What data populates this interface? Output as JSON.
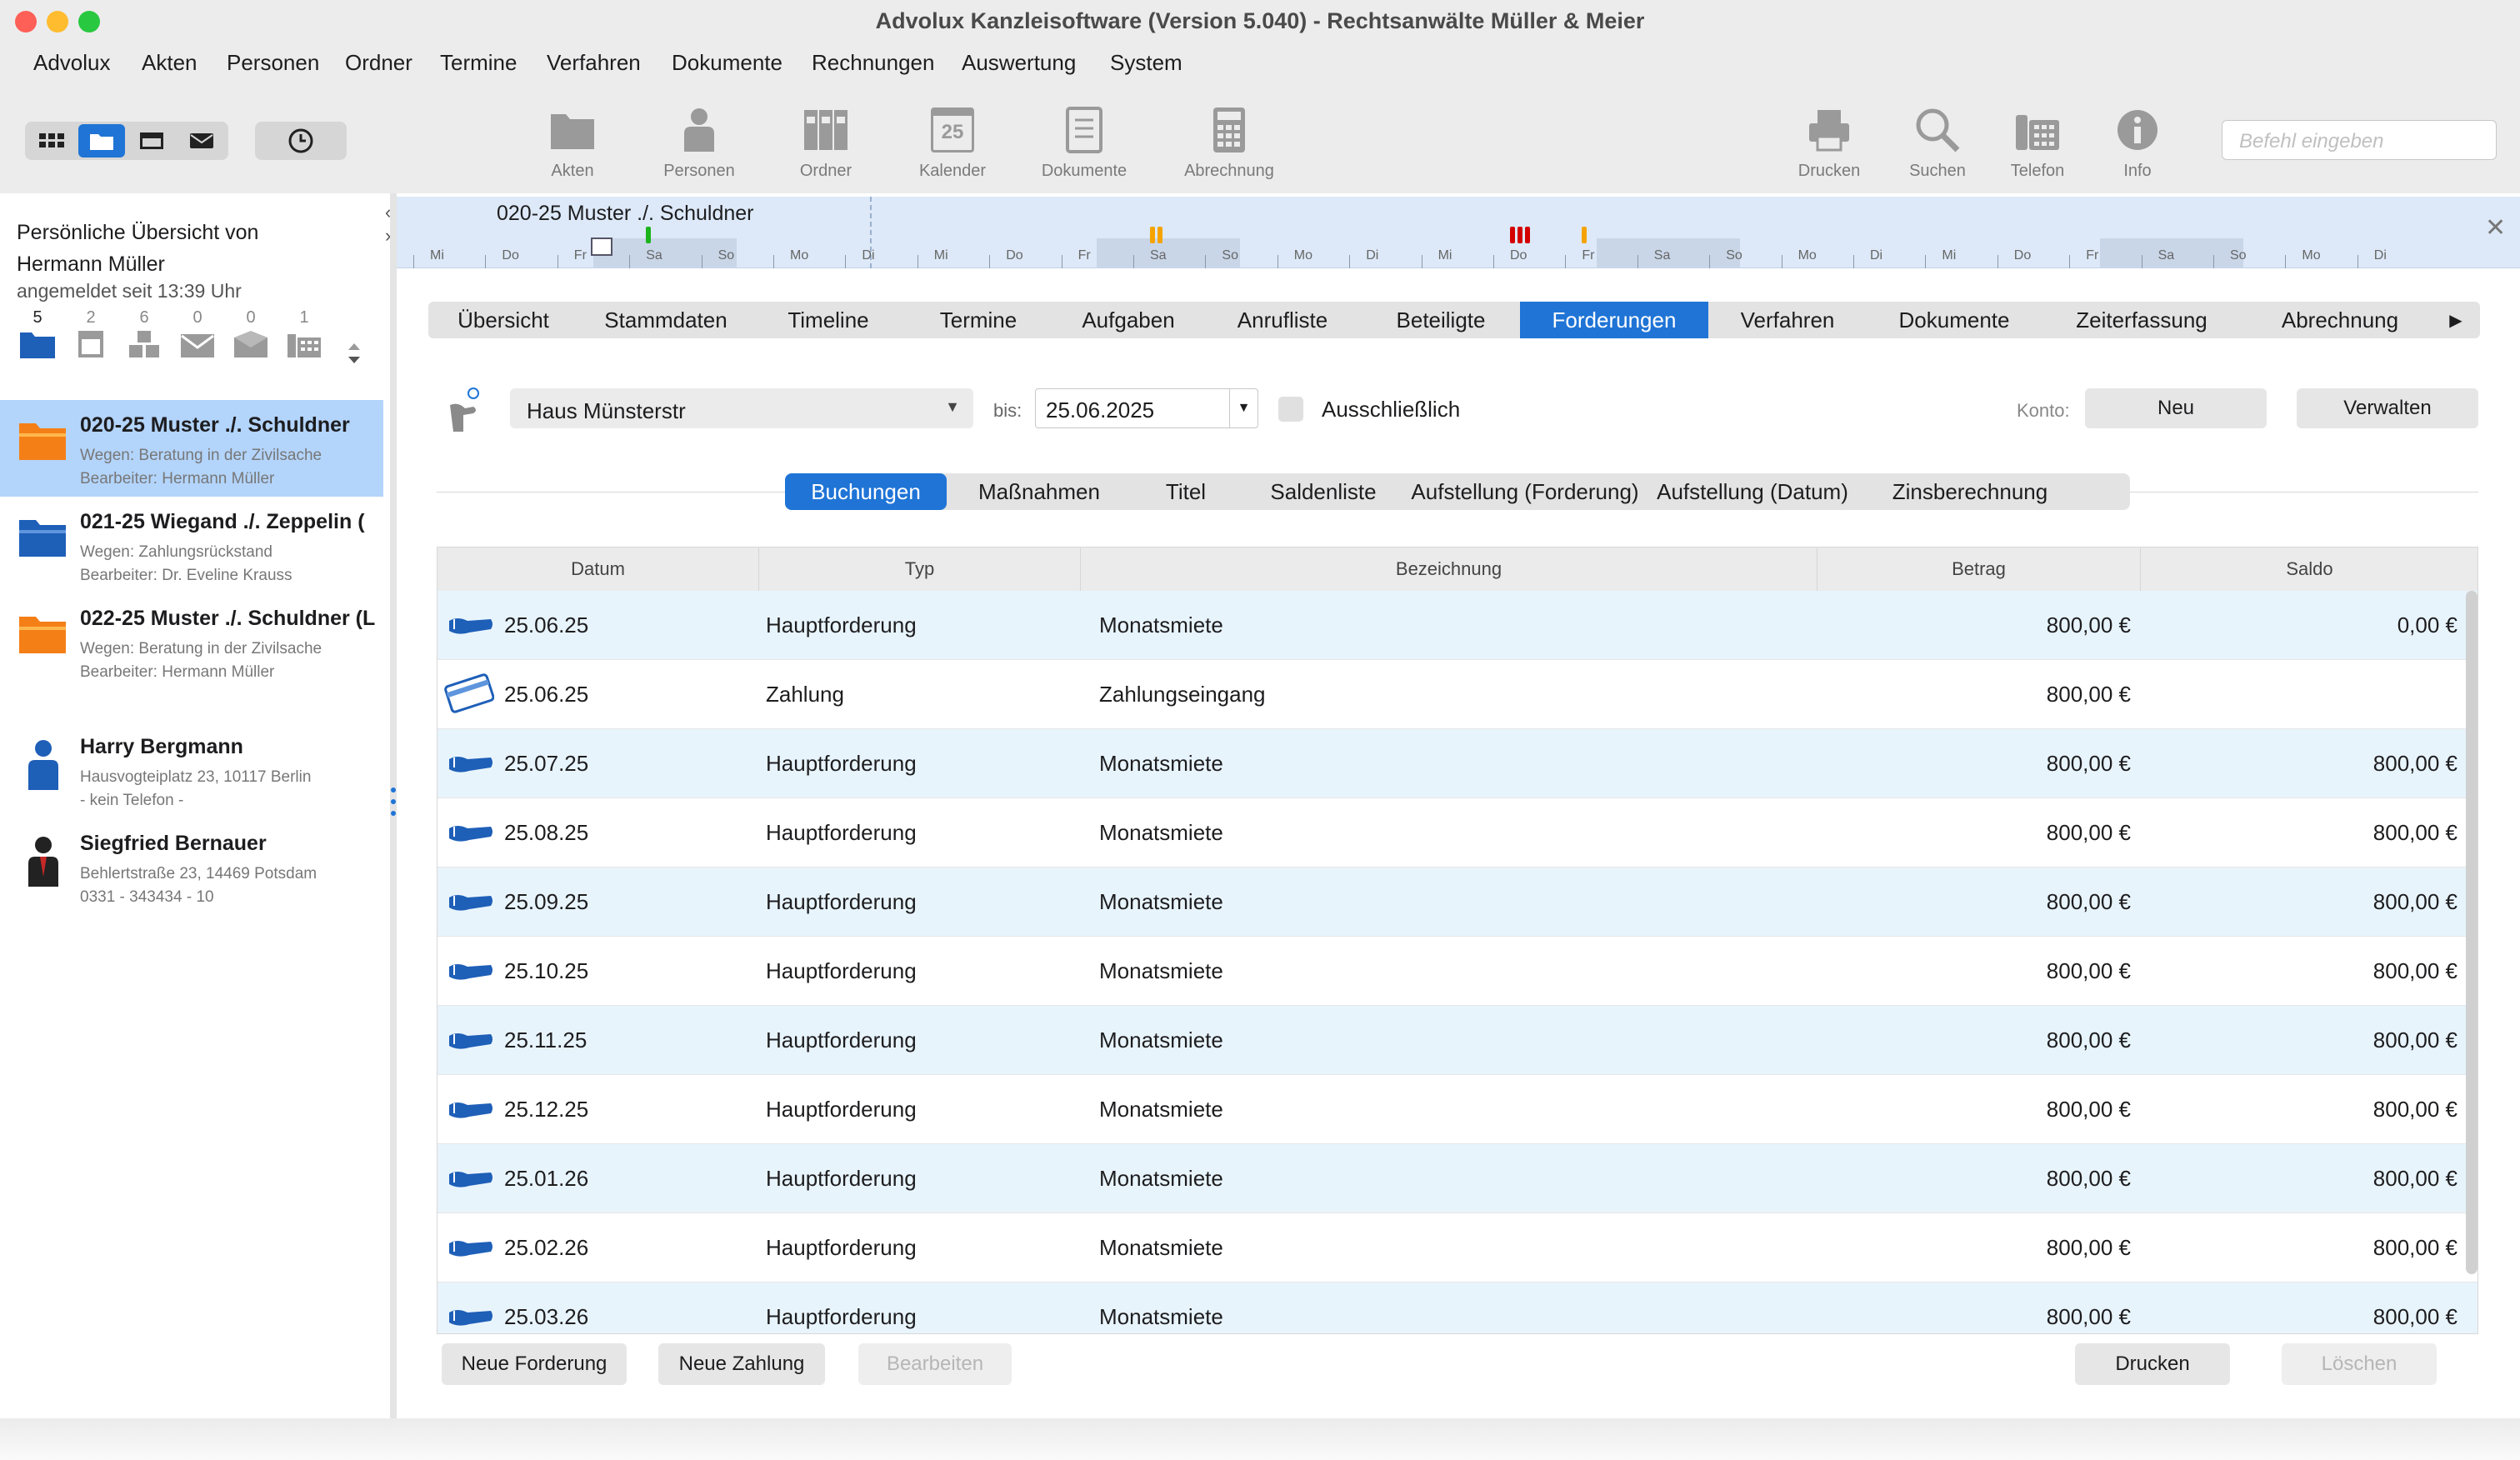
{
  "window": {
    "title": "Advolux Kanzleisoftware (Version 5.040) - Rechtsanwälte Müller & Meier",
    "traffic_colors": [
      "#fe5f57",
      "#febc2e",
      "#28c840"
    ]
  },
  "menu": [
    "Advolux",
    "Akten",
    "Personen",
    "Ordner",
    "Termine",
    "Verfahren",
    "Dokumente",
    "Rechnungen",
    "Auswertung",
    "System"
  ],
  "toolbar": {
    "main": [
      {
        "label": "Akten",
        "icon": "folder-icon"
      },
      {
        "label": "Personen",
        "icon": "person-icon"
      },
      {
        "label": "Ordner",
        "icon": "binders-icon"
      },
      {
        "label": "Kalender",
        "icon": "calendar-icon",
        "day": "25"
      },
      {
        "label": "Dokumente",
        "icon": "document-icon"
      },
      {
        "label": "Abrechnung",
        "icon": "calculator-icon"
      }
    ],
    "right": [
      {
        "label": "Drucken",
        "icon": "printer-icon"
      },
      {
        "label": "Suchen",
        "icon": "magnifier-icon"
      },
      {
        "label": "Telefon",
        "icon": "telephone-icon"
      },
      {
        "label": "Info",
        "icon": "info-icon"
      }
    ],
    "command_placeholder": "Befehl eingeben"
  },
  "sidebar": {
    "greeting_line1": "Persönliche Übersicht von",
    "greeting_line2": "Hermann Müller",
    "since": "angemeldet seit 13:39 Uhr",
    "counters": [
      {
        "count": "5",
        "icon": "folder-icon"
      },
      {
        "count": "2",
        "icon": "calendar-icon"
      },
      {
        "count": "6",
        "icon": "boxes-icon"
      },
      {
        "count": "0",
        "icon": "mail-icon"
      },
      {
        "count": "0",
        "icon": "mail-open-icon"
      },
      {
        "count": "1",
        "icon": "fax-icon"
      }
    ],
    "files": [
      {
        "title": "020-25 Muster ./. Schuldner",
        "sub1": "Wegen: Beratung in der Zivilsache",
        "sub2": "Bearbeiter: Hermann Müller",
        "color": "#f57f17",
        "selected": true
      },
      {
        "title": "021-25 Wiegand ./. Zeppelin (",
        "sub1": "Wegen: Zahlungsrückstand",
        "sub2": "Bearbeiter: Dr. Eveline Krauss",
        "color": "#1e5fb8",
        "selected": false
      },
      {
        "title": "022-25 Muster ./. Schuldner (L",
        "sub1": "Wegen: Beratung in der Zivilsache",
        "sub2": "Bearbeiter: Hermann Müller",
        "color": "#f57f17",
        "selected": false
      }
    ],
    "persons": [
      {
        "name": "Harry Bergmann",
        "sub1": "Hausvogteiplatz 23, 10117 Berlin",
        "sub2": "- kein Telefon -",
        "color": "#1e5fb8"
      },
      {
        "name": "Siegfried Bernauer",
        "sub1": "Behlertstraße 23, 14469 Potsdam",
        "sub2": "0331 - 343434 - 10",
        "color": "#c62828"
      }
    ]
  },
  "timeline": {
    "title": "020-25 Muster ./. Schuldner",
    "days": [
      "Mi",
      "Do",
      "Fr",
      "Sa",
      "So",
      "Mo",
      "Di",
      "Mi",
      "Do",
      "Fr",
      "Sa",
      "So",
      "Mo",
      "Di",
      "Mi",
      "Do",
      "Fr",
      "Sa",
      "So",
      "Mo",
      "Di",
      "Mi",
      "Do",
      "Fr",
      "Sa",
      "So",
      "Mo",
      "Di"
    ],
    "markers": [
      {
        "day_index": 3,
        "color": "#1db31d",
        "kind": "bar"
      },
      {
        "day_index": 10,
        "color": "#f5a300",
        "kind": "double"
      },
      {
        "day_index": 15,
        "color": "#d40000",
        "kind": "triple"
      },
      {
        "day_index": 16,
        "color": "#f5a300",
        "kind": "bar"
      }
    ]
  },
  "tabs": [
    "Übersicht",
    "Stammdaten",
    "Timeline",
    "Termine",
    "Aufgaben",
    "Anrufliste",
    "Beteiligte",
    "Forderungen",
    "Verfahren",
    "Dokumente",
    "Zeiterfassung",
    "Abrechnung"
  ],
  "tabs_selected": "Forderungen",
  "filter": {
    "object": "Haus Münsterstr",
    "bis_label": "bis:",
    "date": "25.06.2025",
    "exclusive_label": "Ausschließlich",
    "exclusive_checked": false,
    "konto_label": "Konto:",
    "new_label": "Neu",
    "manage_label": "Verwalten"
  },
  "subtabs": [
    "Buchungen",
    "Maßnahmen",
    "Titel",
    "Saldenliste",
    "Aufstellung (Forderung)",
    "Aufstellung (Datum)",
    "Zinsberechnung"
  ],
  "subtabs_selected": "Buchungen",
  "table": {
    "columns": [
      "Datum",
      "Typ",
      "Bezeichnung",
      "Betrag",
      "Saldo"
    ],
    "rows": [
      {
        "icon": "claim-icon",
        "datum": "25.06.25",
        "typ": "Hauptforderung",
        "bez": "Monatsmiete",
        "betrag": "800,00 €",
        "saldo": "0,00 €"
      },
      {
        "icon": "payment-card-icon",
        "datum": "25.06.25",
        "typ": "Zahlung",
        "bez": "Zahlungseingang",
        "betrag": "800,00 €",
        "saldo": ""
      },
      {
        "icon": "claim-icon",
        "datum": "25.07.25",
        "typ": "Hauptforderung",
        "bez": "Monatsmiete",
        "betrag": "800,00 €",
        "saldo": "800,00 €"
      },
      {
        "icon": "claim-icon",
        "datum": "25.08.25",
        "typ": "Hauptforderung",
        "bez": "Monatsmiete",
        "betrag": "800,00 €",
        "saldo": "800,00 €"
      },
      {
        "icon": "claim-icon",
        "datum": "25.09.25",
        "typ": "Hauptforderung",
        "bez": "Monatsmiete",
        "betrag": "800,00 €",
        "saldo": "800,00 €"
      },
      {
        "icon": "claim-icon",
        "datum": "25.10.25",
        "typ": "Hauptforderung",
        "bez": "Monatsmiete",
        "betrag": "800,00 €",
        "saldo": "800,00 €"
      },
      {
        "icon": "claim-icon",
        "datum": "25.11.25",
        "typ": "Hauptforderung",
        "bez": "Monatsmiete",
        "betrag": "800,00 €",
        "saldo": "800,00 €"
      },
      {
        "icon": "claim-icon",
        "datum": "25.12.25",
        "typ": "Hauptforderung",
        "bez": "Monatsmiete",
        "betrag": "800,00 €",
        "saldo": "800,00 €"
      },
      {
        "icon": "claim-icon",
        "datum": "25.01.26",
        "typ": "Hauptforderung",
        "bez": "Monatsmiete",
        "betrag": "800,00 €",
        "saldo": "800,00 €"
      },
      {
        "icon": "claim-icon",
        "datum": "25.02.26",
        "typ": "Hauptforderung",
        "bez": "Monatsmiete",
        "betrag": "800,00 €",
        "saldo": "800,00 €"
      },
      {
        "icon": "claim-icon",
        "datum": "25.03.26",
        "typ": "Hauptforderung",
        "bez": "Monatsmiete",
        "betrag": "800,00 €",
        "saldo": "800,00 €"
      }
    ]
  },
  "bottom": {
    "new_claim": "Neue Forderung",
    "new_payment": "Neue Zahlung",
    "edit": "Bearbeiten",
    "print": "Drucken",
    "delete": "Löschen"
  },
  "colors": {
    "accent": "#1f74d6",
    "row_alt": "#e8f4fc",
    "selection": "#b3d4fb"
  }
}
